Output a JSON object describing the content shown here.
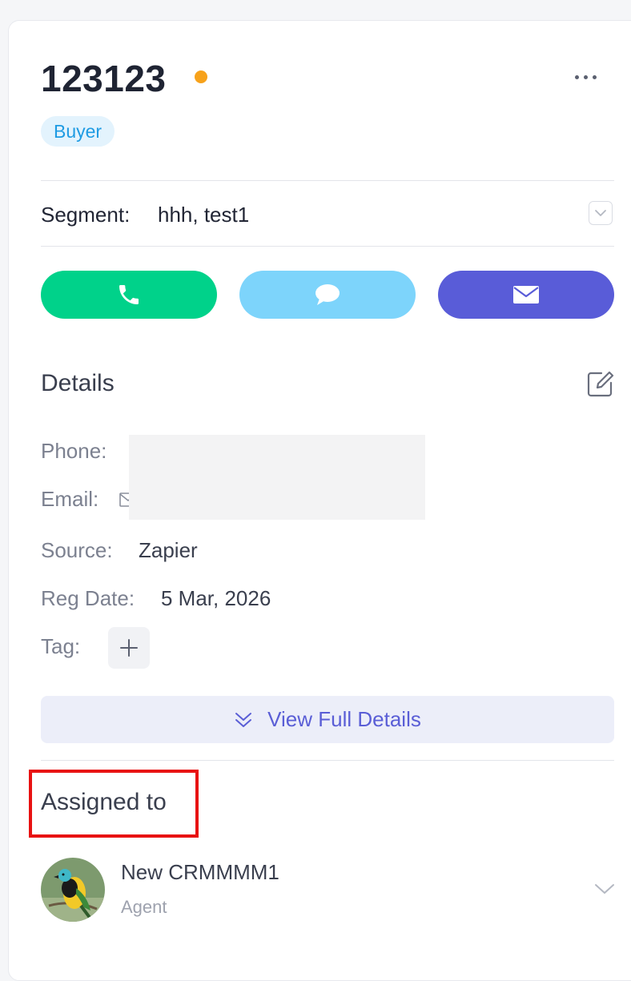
{
  "contact": {
    "name": "123123",
    "status_color": "#f7a21b",
    "type_badge": "Buyer",
    "more_icon": "more-horizontal-icon"
  },
  "segment": {
    "label": "Segment:",
    "value": "hhh, test1",
    "dropdown_icon": "chevron-down-icon"
  },
  "actions": [
    {
      "name": "call",
      "icon": "phone-icon",
      "color": "#00d28a"
    },
    {
      "name": "chat",
      "icon": "chat-bubble-icon",
      "color": "#7dd4fb"
    },
    {
      "name": "email",
      "icon": "envelope-icon",
      "color": "#595cd8"
    }
  ],
  "details": {
    "title": "Details",
    "edit_icon": "edit-icon",
    "phone_label": "Phone:",
    "email_label": "Email:",
    "source_label": "Source:",
    "source_value": "Zapier",
    "reg_date_label": "Reg Date:",
    "reg_date_value": "5 Mar, 2026",
    "tag_label": "Tag:",
    "tag_add_icon": "plus-icon",
    "view_full_label": "View Full Details",
    "view_full_icon": "double-chevron-down-icon"
  },
  "assigned": {
    "title": "Assigned to",
    "highlight_color": "#e81212",
    "agent_name": "New CRMMMM1",
    "agent_role": "Agent",
    "avatar_icon": "bird-avatar",
    "chevron_icon": "chevron-down-icon"
  }
}
